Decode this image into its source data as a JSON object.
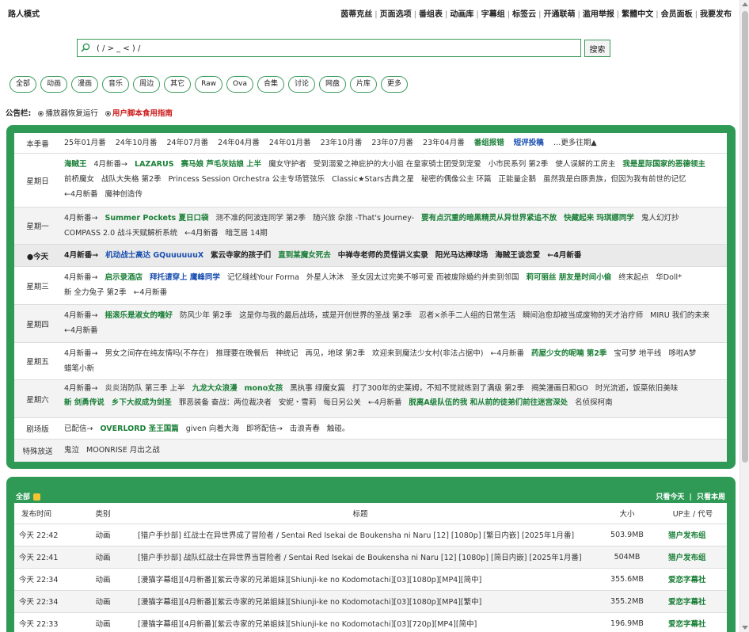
{
  "header": {
    "mode": "路人模式",
    "links": [
      "茵蒂克丝",
      "页面选项",
      "番组表",
      "动画库",
      "字幕组",
      "标签云",
      "开通联萌",
      "滥用举报",
      "繁體中文",
      "会员面板",
      "我要发布"
    ]
  },
  "search": {
    "value": "( / > _ < ) /",
    "button": "搜索"
  },
  "categories": [
    "全部",
    "动画",
    "漫画",
    "音乐",
    "周边",
    "其它",
    "Raw",
    "Ova",
    "合集",
    "讨论",
    "网盘",
    "片库",
    "更多"
  ],
  "notice": {
    "label": "公告栏:",
    "item1": "播放器恢复运行",
    "item2": "用户脚本食用指南"
  },
  "schedule": {
    "seasons": [
      "本季番",
      "25年01月番",
      "24年10月番",
      "24年07月番",
      "24年04月番",
      "24年01月番",
      "23年10月番",
      "23年07月番",
      "23年04月番",
      "番组报错",
      "短评投稿",
      "…更多往期▲"
    ],
    "days": {
      "sun": "星期日",
      "mon": "星期一",
      "today": "●今天",
      "wed": "星期三",
      "thu": "星期四",
      "fri": "星期五",
      "sat": "星期六",
      "theatrical": "剧场版",
      "special": "特殊放送"
    },
    "sun_items": [
      "海贼王",
      "4月新番→",
      "LAZARUS",
      "赛马娘 芦毛灰姑娘 上半",
      "魔女守护者",
      "受到溺爱之神庇护的大小姐 在皇家骑士团受到宠爱",
      "小市民系列 第2季",
      "使人误解的工房主",
      "我是星际国家的恶德领主",
      "前桥魔女",
      "战队大失格 第2季",
      "Princess Session Orchestra 公主专场管弦乐",
      "Classic★Stars古典之星",
      "秘密的偶像公主 环篇",
      "正能量企鹅",
      "虽然我是白豚贵族，但因为我有前世的记忆",
      "←4月新番",
      "魔神创造传"
    ],
    "mon_items": [
      "4月新番→",
      "Summer Pockets 夏日口袋",
      "测不准的阿波连同学 第2季",
      "随兴旅 杂旅 -That's Journey-",
      "要有点沉重的暗黑精灵从异世界紧追不放",
      "快藏起来 玛琪娜同学",
      "鬼人幻灯抄",
      "COMPASS 2.0 战斗天赋解析系统",
      "←4月新番",
      "暗芝居 14期"
    ],
    "today_items": [
      "4月新番→",
      "机动战士高达 GQuuuuuuX",
      "紫云寺家的孩子们",
      "直到某魔女死去",
      "中禅寺老师的灵怪讲义实录",
      "阳光马达棒球场",
      "海贼王谈恋爱",
      "←4月新番"
    ],
    "wed_items": [
      "4月新番→",
      "启示录酒店",
      "拜托请穿上 鹰峰同学",
      "记忆缝线Your Forma",
      "外星人沐沐",
      "圣女因太过完美不够可爱 而被废除婚约并卖到邻国",
      "莉可丽丝 朋友是时间小偷",
      "终末起点",
      "华Doll*",
      "新 全力兔子 第2季",
      "←4月新番"
    ],
    "thu_items": [
      "4月新番→",
      "摇滚乐是淑女的嗜好",
      "防风少年 第2季",
      "这是你与我的最后战场，或是开创世界的圣战 第2季",
      "忍者×杀手二人组的日常生活",
      "瞬间治愈却被当成废物的天才治疗师",
      "MIRU 我们的未来",
      "←4月新番"
    ],
    "fri_items": [
      "4月新番→",
      "男女之间存在纯友情吗(不存在)",
      "推理要在晚餐后",
      "神统记",
      "再见，地球 第2季",
      "欢迎来到魔法少女村(非法占据中)",
      "←4月新番",
      "药屋少女的呢喃 第2季",
      "宝可梦 地平线",
      "哆啦A梦",
      "蜡笔小新"
    ],
    "sat_items": [
      "4月新番→",
      "炎炎消防队 第三季 上半",
      "九龙大众浪漫",
      "mono女孩",
      "黑执事 绿魔女篇",
      "打了300年的史莱姆，不知不觉就练到了满级 第2季",
      "揭笑漫画日和GO",
      "时光流逝，饭菜依旧美味",
      "新 剑勇传说",
      "乡下大叔成为剑圣",
      "罪恶装备 奋战：两位裁决者",
      "安妮・雪莉",
      "每日另公关",
      "←4月新番",
      "脱离A级队伍的我 和从前的徒弟们前往迷宫深处",
      "名侦探柯南"
    ],
    "theatrical_items": [
      "已配信→",
      "OVERLORD 圣王国篇",
      "given 向着大海",
      "即将配信→",
      "击浪青春",
      "触碰。"
    ],
    "special_items": [
      "鬼泣",
      "MOONRISE 月出之战"
    ]
  },
  "list": {
    "label": "全部",
    "right_links": [
      "只看今天",
      "只看本周"
    ],
    "columns": [
      "发布时间",
      "类别",
      "标题",
      "大小",
      "UP主 / 代号"
    ],
    "rows": [
      {
        "time": "今天 22:42",
        "type": "动画",
        "title": "[猎户手抄部] 红战士在异世界成了冒险者 / Sentai Red Isekai de Boukensha ni Naru [12] [1080p] [繁日内嵌] [2025年1月番]",
        "size": "503.9MB",
        "up": "猎户发布组"
      },
      {
        "time": "今天 22:41",
        "type": "动画",
        "title": "[猎户手抄部] 战队红战士在异世界当冒险者 / Sentai Red Isekai de Boukensha ni Naru [12] [1080p] [简日内嵌] [2025年1月番]",
        "size": "504MB",
        "up": "猎户发布组"
      },
      {
        "time": "今天 22:34",
        "type": "动画",
        "title": "[漫猫字幕组][4月新番][紫云寺家的兄弟姐妹][Shiunji-ke no Kodomotachi][03][1080p][MP4][简中]",
        "size": "355.6MB",
        "up": "爱恋字幕社"
      },
      {
        "time": "今天 22:34",
        "type": "动画",
        "title": "[漫猫字幕组][4月新番][紫云寺家的兄弟姐妹][Shiunji-ke no Kodomotachi][03][1080p][MP4][繁中]",
        "size": "355.2MB",
        "up": "爱恋字幕社"
      },
      {
        "time": "今天 22:33",
        "type": "动画",
        "title": "[漫猫字幕组][4月新番][紫云寺家的兄弟姐妹][Shiunji-ke no Kodomotachi][03][720p][MP4][简中]",
        "size": "196.9MB",
        "up": "爱恋字幕社"
      }
    ]
  },
  "colors": {
    "accent": "#2e9a55",
    "link_green": "#1a7f37",
    "link_blue": "#1a4fb0",
    "notice_red": "#cc1a1a"
  }
}
